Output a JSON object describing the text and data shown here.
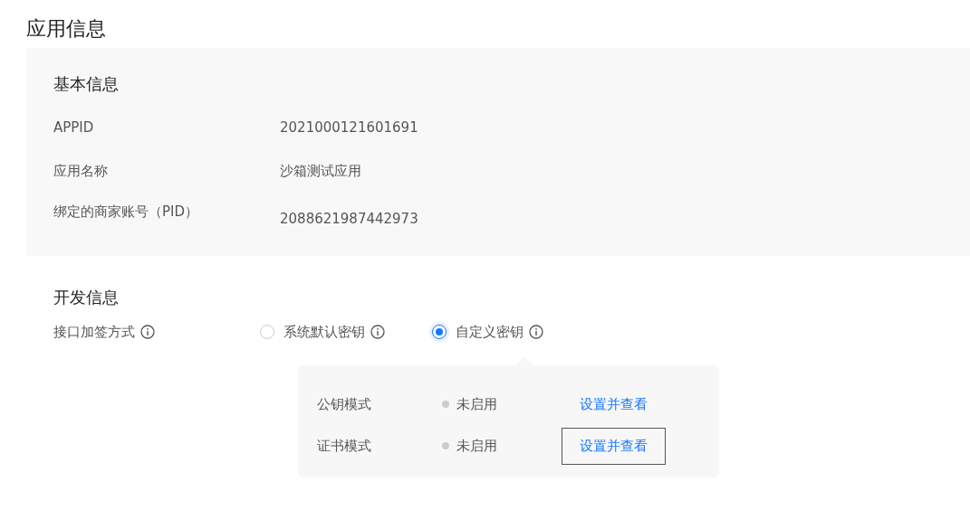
{
  "page_title": "应用信息",
  "basic_info": {
    "heading": "基本信息",
    "rows": [
      {
        "label": "APPID",
        "value": "2021000121601691"
      },
      {
        "label": "应用名称",
        "value": "沙箱测试应用"
      },
      {
        "label": "绑定的商家账号（PID）",
        "value": "2088621987442973"
      }
    ]
  },
  "dev_info": {
    "heading": "开发信息",
    "sign_method": {
      "label": "接口加签方式",
      "options": [
        {
          "label": "系统默认密钥",
          "selected": false
        },
        {
          "label": "自定义密钥",
          "selected": true
        }
      ]
    },
    "key_modes": [
      {
        "name": "公钥模式",
        "status": "未启用",
        "action": "设置并查看",
        "highlighted": false
      },
      {
        "name": "证书模式",
        "status": "未启用",
        "action": "设置并查看",
        "highlighted": true
      }
    ]
  }
}
